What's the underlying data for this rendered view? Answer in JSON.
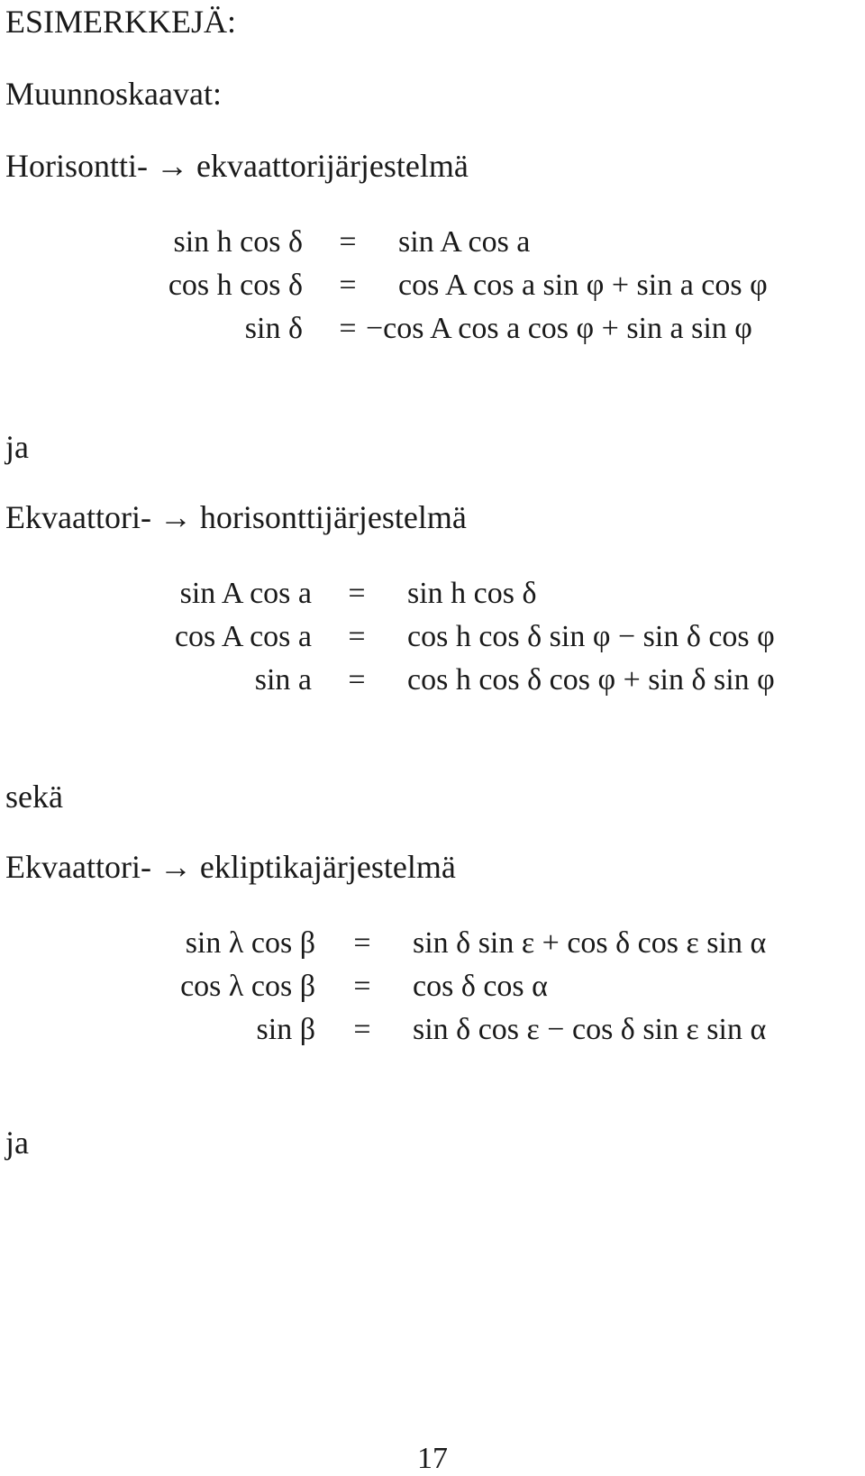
{
  "heading": "ESIMERKKEJÄ:",
  "subheading": "Muunnoskaavat:",
  "sections": [
    {
      "title": "Horisontti- → ekvaattorijärjestelmä",
      "equations": [
        {
          "lhs": "sin h cos δ",
          "op": "=",
          "rhs": "sin A cos a"
        },
        {
          "lhs": "cos h cos δ",
          "op": "=",
          "rhs": "cos A cos a sin φ + sin a cos φ"
        },
        {
          "lhs": "sin δ",
          "op": "=",
          "rhs": "−cos A cos a cos φ + sin a sin φ"
        }
      ]
    },
    {
      "connector": "ja",
      "title": "Ekvaattori- → horisonttijärjestelmä",
      "equations": [
        {
          "lhs": "sin A cos a",
          "op": "=",
          "rhs": "sin h cos δ"
        },
        {
          "lhs": "cos A cos a",
          "op": "=",
          "rhs": "cos h cos δ sin φ − sin δ cos φ"
        },
        {
          "lhs": "sin a",
          "op": "=",
          "rhs": "cos h cos δ cos φ + sin δ sin φ"
        }
      ]
    },
    {
      "connector": "sekä",
      "title": "Ekvaattori- → ekliptikajärjestelmä",
      "equations": [
        {
          "lhs": "sin λ cos β",
          "op": "=",
          "rhs": "sin δ sin ε + cos δ cos ε sin α"
        },
        {
          "lhs": "cos λ cos β",
          "op": "=",
          "rhs": "cos δ cos α"
        },
        {
          "lhs": "sin β",
          "op": "=",
          "rhs": "sin δ cos ε − cos δ sin ε sin α"
        }
      ]
    }
  ],
  "trailing_connector": "ja",
  "page_number": "17"
}
